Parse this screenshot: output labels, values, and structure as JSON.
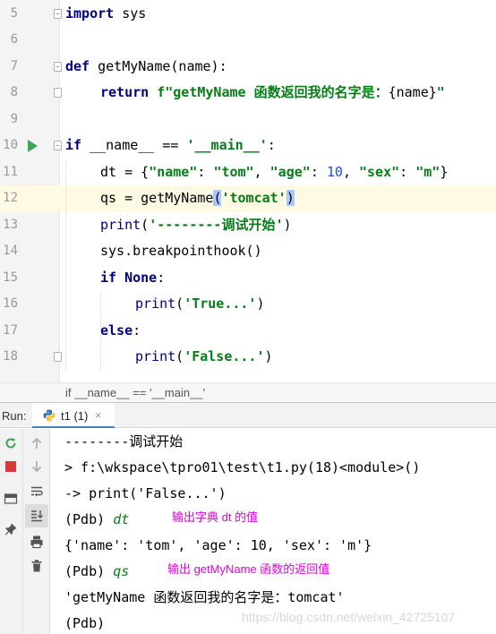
{
  "editor": {
    "lines": [
      {
        "no": "5",
        "tokens": [
          {
            "t": "import",
            "c": "kw"
          },
          {
            "t": " sys",
            "c": ""
          }
        ],
        "fold": "open"
      },
      {
        "no": "6",
        "tokens": []
      },
      {
        "no": "7",
        "tokens": [
          {
            "t": "def",
            "c": "kw"
          },
          {
            "t": " getMyName",
            "c": ""
          },
          {
            "t": "(name):",
            "c": ""
          }
        ],
        "fold": "open"
      },
      {
        "no": "8",
        "indent": 1,
        "tokens": [
          {
            "t": "return ",
            "c": "kw"
          },
          {
            "t": "f\"getMyName 函数返回我的名字是：",
            "c": "str"
          },
          {
            "t": "{name}",
            "c": ""
          },
          {
            "t": "\"",
            "c": "str"
          }
        ],
        "fold": "close"
      },
      {
        "no": "9",
        "tokens": []
      },
      {
        "no": "10",
        "run": true,
        "tokens": [
          {
            "t": "if",
            "c": "kw"
          },
          {
            "t": " __name__ == ",
            "c": ""
          },
          {
            "t": "'__main__'",
            "c": "str"
          },
          {
            "t": ":",
            "c": ""
          }
        ],
        "fold": "open"
      },
      {
        "no": "11",
        "indent": 1,
        "tokens": [
          {
            "t": "dt = {",
            "c": ""
          },
          {
            "t": "\"name\"",
            "c": "str"
          },
          {
            "t": ": ",
            "c": ""
          },
          {
            "t": "\"tom\"",
            "c": "str"
          },
          {
            "t": ", ",
            "c": ""
          },
          {
            "t": "\"age\"",
            "c": "str"
          },
          {
            "t": ": ",
            "c": ""
          },
          {
            "t": "10",
            "c": "num"
          },
          {
            "t": ", ",
            "c": ""
          },
          {
            "t": "\"sex\"",
            "c": "str"
          },
          {
            "t": ": ",
            "c": ""
          },
          {
            "t": "\"m\"",
            "c": "str"
          },
          {
            "t": "}",
            "c": ""
          }
        ]
      },
      {
        "no": "12",
        "indent": 1,
        "current": true,
        "tokens": [
          {
            "t": "qs = getMyName",
            "c": ""
          },
          {
            "t": "(",
            "c": "sel"
          },
          {
            "t": "'tomcat'",
            "c": "str"
          },
          {
            "t": ")",
            "c": "sel"
          }
        ]
      },
      {
        "no": "13",
        "indent": 1,
        "tokens": [
          {
            "t": "print",
            "c": "fnc"
          },
          {
            "t": "(",
            "c": ""
          },
          {
            "t": "'--------调试开始'",
            "c": "str"
          },
          {
            "t": ")",
            "c": ""
          }
        ]
      },
      {
        "no": "14",
        "indent": 1,
        "tokens": [
          {
            "t": "sys.breakpointhook()",
            "c": ""
          }
        ]
      },
      {
        "no": "15",
        "indent": 1,
        "tokens": [
          {
            "t": "if ",
            "c": "kw"
          },
          {
            "t": "None",
            "c": "kw"
          },
          {
            "t": ":",
            "c": ""
          }
        ]
      },
      {
        "no": "16",
        "indent": 2,
        "tokens": [
          {
            "t": "print",
            "c": "fnc"
          },
          {
            "t": "(",
            "c": ""
          },
          {
            "t": "'True...'",
            "c": "str"
          },
          {
            "t": ")",
            "c": ""
          }
        ]
      },
      {
        "no": "17",
        "indent": 1,
        "tokens": [
          {
            "t": "else",
            "c": "kw"
          },
          {
            "t": ":",
            "c": ""
          }
        ]
      },
      {
        "no": "18",
        "indent": 2,
        "tokens": [
          {
            "t": "print",
            "c": "fnc"
          },
          {
            "t": "(",
            "c": ""
          },
          {
            "t": "'False...'",
            "c": "str"
          },
          {
            "t": ")",
            "c": ""
          }
        ],
        "fold": "close"
      }
    ],
    "breadcrumb": "if __name__ == '__main__'"
  },
  "run_panel": {
    "label": "Run:",
    "tab_label": "t1 (1)",
    "tab_close": "×",
    "icons_left": [
      "rerun-icon",
      "stop-icon",
      "layout-icon",
      "pin-icon"
    ],
    "icons_right": [
      "up-arrow-icon",
      "down-arrow-icon",
      "soft-wrap-icon",
      "scroll-to-end-icon",
      "print-icon",
      "trash-icon"
    ],
    "console": [
      {
        "parts": [
          {
            "t": "--------调试开始",
            "c": ""
          }
        ]
      },
      {
        "parts": [
          {
            "t": "> f:\\wkspace\\tpro01\\test\\t1.py(18)<module>()",
            "c": ""
          }
        ]
      },
      {
        "parts": [
          {
            "t": "-> print('False...')",
            "c": ""
          }
        ]
      },
      {
        "parts": [
          {
            "t": "(Pdb) ",
            "c": ""
          },
          {
            "t": "dt",
            "c": "pdb-input"
          }
        ],
        "annotation": "输出字典 dt 的值"
      },
      {
        "parts": [
          {
            "t": "{'name': 'tom', 'age': 10, 'sex': 'm'}",
            "c": ""
          }
        ]
      },
      {
        "parts": [
          {
            "t": "(Pdb) ",
            "c": ""
          },
          {
            "t": "qs",
            "c": "pdb-input"
          }
        ],
        "annotation": "输出 getMyName 函数的返回值"
      },
      {
        "parts": [
          {
            "t": "'getMyName 函数返回我的名字是：tomcat'",
            "c": ""
          }
        ]
      },
      {
        "parts": [
          {
            "t": "(Pdb)",
            "c": ""
          }
        ]
      }
    ],
    "watermark": "https://blog.csdn.net/weixin_42725107"
  },
  "colors": {
    "keyword": "#000080",
    "string": "#067d17",
    "number": "#1750eb",
    "annotation": "#e000e0",
    "current_line": "#fffae3",
    "run_arrow": "#3aa857"
  }
}
